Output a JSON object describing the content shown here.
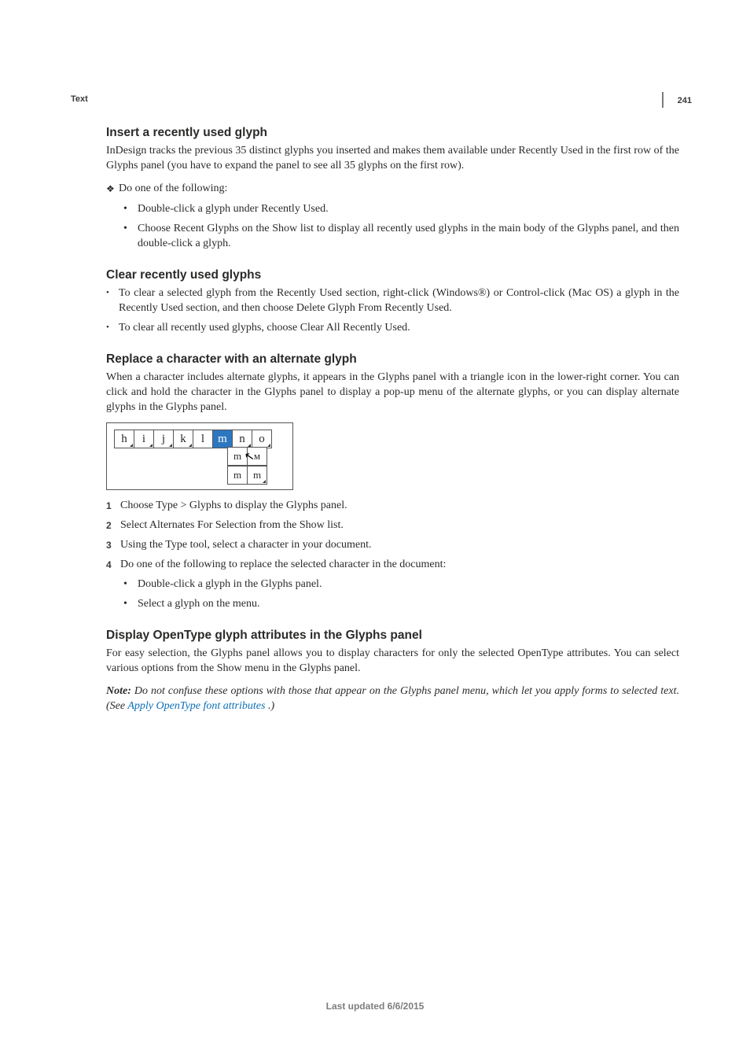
{
  "page": {
    "number": "241",
    "section_label": "Text",
    "footer": "Last updated 6/6/2015"
  },
  "sections": {
    "insert": {
      "heading": "Insert a recently used glyph",
      "body": "InDesign tracks the previous 35 distinct glyphs you inserted and makes them available under Recently Used in the first row of the Glyphs panel (you have to expand the panel to see all 35 glyphs on the first row).",
      "lead": "Do one of the following:",
      "bullets": [
        "Double-click a glyph under Recently Used.",
        "Choose Recent Glyphs on the Show list to display all recently used glyphs in the main body of the Glyphs panel, and then double-click a glyph."
      ]
    },
    "clear": {
      "heading": "Clear recently used glyphs",
      "bullets": [
        "To clear a selected glyph from the Recently Used section, right-click (Windows®) or Control-click (Mac OS) a glyph in the Recently Used section, and then choose Delete Glyph From Recently Used.",
        "To clear all recently used glyphs, choose Clear All Recently Used."
      ]
    },
    "replace": {
      "heading": "Replace a character with an alternate glyph",
      "body": "When a character includes alternate glyphs, it appears in the Glyphs panel with a triangle icon in the lower-right corner. You can click and hold the character in the Glyphs panel to display a pop-up menu of the alternate glyphs, or you can display alternate glyphs in the Glyphs panel.",
      "steps": [
        "Choose Type > Glyphs to display the Glyphs panel.",
        "Select Alternates For Selection from the Show list.",
        "Using the Type tool, select a character in your document.",
        "Do one of the following to replace the selected character in the document:"
      ],
      "sub_bullets": [
        "Double-click a glyph in the Glyphs panel.",
        "Select a glyph on the menu."
      ]
    },
    "display": {
      "heading": "Display OpenType glyph attributes in the Glyphs panel",
      "body": "For easy selection, the Glyphs panel allows you to display characters for only the selected OpenType attributes. You can select various options from the Show menu in the Glyphs panel.",
      "note_label": "Note:",
      "note_before": " Do not confuse these options with those that appear on the Glyphs panel menu, which let you apply forms to selected text. (See ",
      "note_link": "Apply OpenType font attributes",
      "note_after": " .)"
    }
  },
  "figure": {
    "row1": [
      "h",
      "i",
      "j",
      "k",
      "l",
      "m",
      "n",
      "o"
    ],
    "selected_index": 5,
    "popup1": [
      "m",
      "ᴍ"
    ],
    "popup2": [
      "m",
      "m"
    ]
  }
}
